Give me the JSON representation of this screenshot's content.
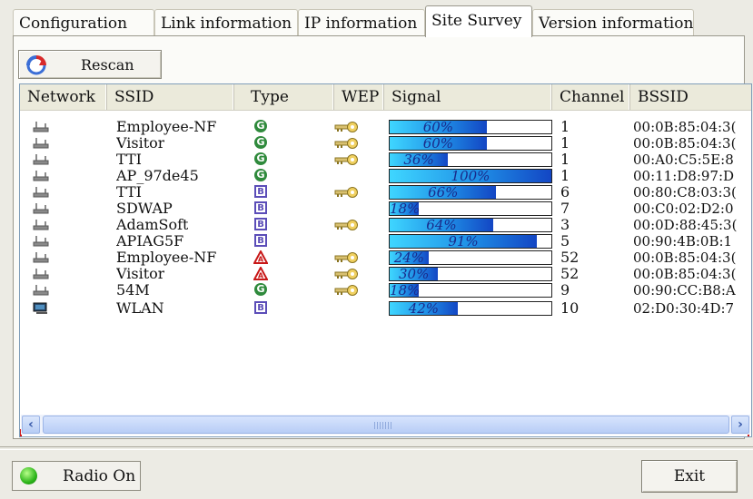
{
  "tabs": [
    {
      "label": "Configuration"
    },
    {
      "label": "Link information"
    },
    {
      "label": "IP information"
    },
    {
      "label": "Site Survey"
    },
    {
      "label": "Version information"
    }
  ],
  "active_tab": "Site Survey",
  "rescan_label": "Rescan",
  "columns": [
    "Network",
    "SSID",
    "Type",
    "WEP",
    "Signal",
    "Channel",
    "BSSID"
  ],
  "rows": [
    {
      "ssid": "Employee-NF",
      "type": "G",
      "wep": true,
      "signal": 60,
      "signal_text": "60%",
      "channel": "1",
      "bssid": "00:0B:85:04:3("
    },
    {
      "ssid": "Visitor",
      "type": "G",
      "wep": true,
      "signal": 60,
      "signal_text": "60%",
      "channel": "1",
      "bssid": "00:0B:85:04:3("
    },
    {
      "ssid": "TTI",
      "type": "G",
      "wep": true,
      "signal": 36,
      "signal_text": "36%",
      "channel": "1",
      "bssid": "00:A0:C5:5E:8"
    },
    {
      "ssid": "AP_97de45",
      "type": "G",
      "wep": false,
      "signal": 100,
      "signal_text": "100%",
      "channel": "1",
      "bssid": "00:11:D8:97:D"
    },
    {
      "ssid": "TTI",
      "type": "B",
      "wep": true,
      "signal": 66,
      "signal_text": "66%",
      "channel": "6",
      "bssid": "00:80:C8:03:3("
    },
    {
      "ssid": "SDWAP",
      "type": "B",
      "wep": false,
      "signal": 18,
      "signal_text": "18%",
      "channel": "7",
      "bssid": "00:C0:02:D2:0"
    },
    {
      "ssid": "AdamSoft",
      "type": "B",
      "wep": true,
      "signal": 64,
      "signal_text": "64%",
      "channel": "3",
      "bssid": "00:0D:88:45:3("
    },
    {
      "ssid": "APIAG5F",
      "type": "B",
      "wep": false,
      "signal": 91,
      "signal_text": "91%",
      "channel": "5",
      "bssid": "00:90:4B:0B:1"
    },
    {
      "ssid": "Employee-NF",
      "type": "A",
      "wep": true,
      "signal": 24,
      "signal_text": "24%",
      "channel": "52",
      "bssid": "00:0B:85:04:3("
    },
    {
      "ssid": "Visitor",
      "type": "A",
      "wep": true,
      "signal": 30,
      "signal_text": "30%",
      "channel": "52",
      "bssid": "00:0B:85:04:3("
    },
    {
      "ssid": "54M",
      "type": "G",
      "wep": true,
      "signal": 18,
      "signal_text": "18%",
      "channel": "9",
      "bssid": "00:90:CC:B8:A"
    },
    {
      "ssid": "WLAN",
      "type": "B",
      "wep": false,
      "signal": 42,
      "signal_text": "42%",
      "channel": "10",
      "bssid": "02:D0:30:4D:7",
      "selected": true,
      "net_icon": "computer-icon"
    }
  ],
  "radio_label": "Radio On",
  "exit_label": "Exit",
  "colors": {
    "highlight": "#d01818",
    "signal_start": "#3fd6ff",
    "signal_end": "#1346c4",
    "radio_led": "#2db51a"
  }
}
